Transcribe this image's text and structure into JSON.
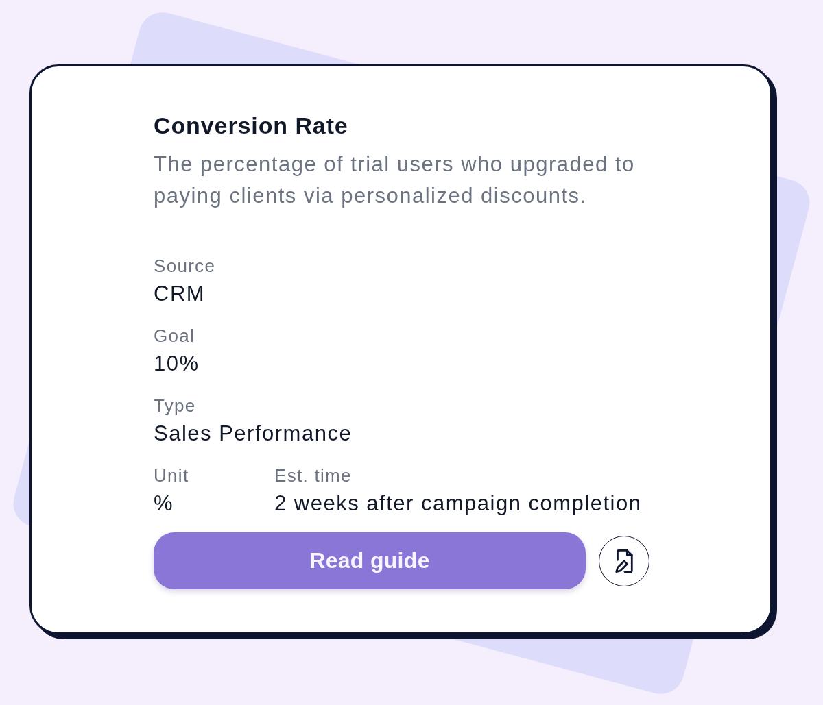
{
  "card": {
    "title": "Conversion Rate",
    "description": "The percentage of trial users who upgraded to paying clients via personalized discounts.",
    "fields": [
      {
        "label": "Source",
        "value": "CRM"
      },
      {
        "label": "Goal",
        "value": "10%"
      },
      {
        "label": "Type",
        "value": "Sales Performance"
      }
    ],
    "inline_fields": [
      {
        "label": "Unit",
        "value": "%"
      },
      {
        "label": "Est. time",
        "value": "2 weeks after campaign completion"
      }
    ],
    "primary_button": "Read guide"
  }
}
